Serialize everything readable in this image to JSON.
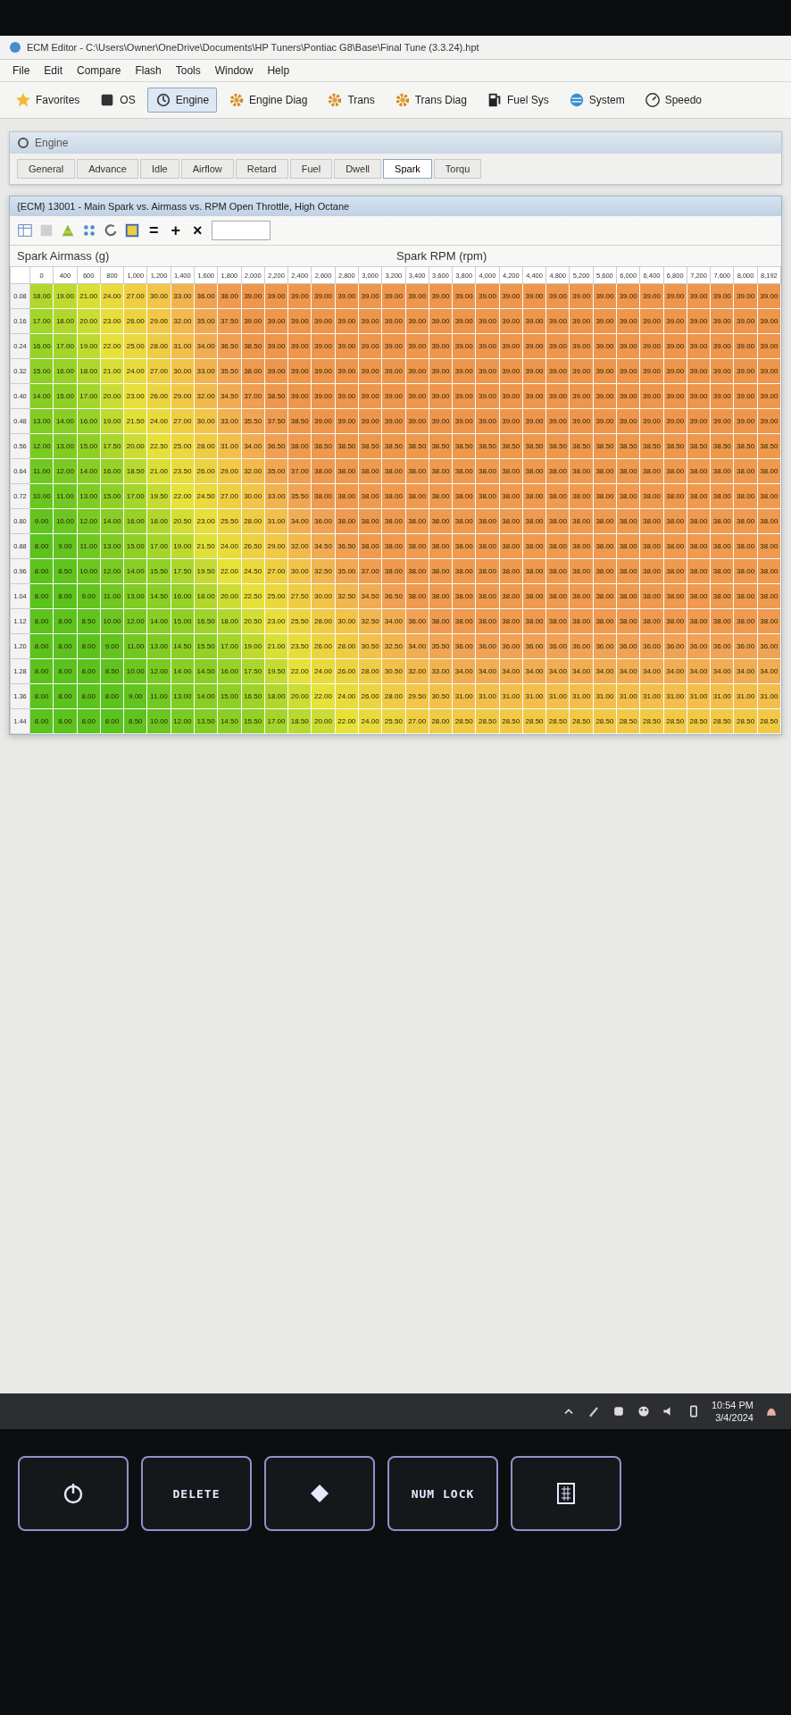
{
  "window": {
    "title": "ECM Editor - C:\\Users\\Owner\\OneDrive\\Documents\\HP Tuners\\Pontiac G8\\Base\\Final Tune (3.3.24).hpt"
  },
  "menu": [
    "File",
    "Edit",
    "Compare",
    "Flash",
    "Tools",
    "Window",
    "Help"
  ],
  "toolbar": [
    {
      "label": "Favorites",
      "selected": false
    },
    {
      "label": "OS",
      "selected": false
    },
    {
      "label": "Engine",
      "selected": true
    },
    {
      "label": "Engine Diag",
      "selected": false
    },
    {
      "label": "Trans",
      "selected": false
    },
    {
      "label": "Trans Diag",
      "selected": false
    },
    {
      "label": "Fuel Sys",
      "selected": false
    },
    {
      "label": "System",
      "selected": false
    },
    {
      "label": "Speedo",
      "selected": false
    }
  ],
  "engine_panel": {
    "title": "Engine",
    "tabs": [
      {
        "label": "General",
        "selected": false
      },
      {
        "label": "Advance",
        "selected": false
      },
      {
        "label": "Idle",
        "selected": false
      },
      {
        "label": "Airflow",
        "selected": false
      },
      {
        "label": "Retard",
        "selected": false
      },
      {
        "label": "Fuel",
        "selected": false
      },
      {
        "label": "Dwell",
        "selected": false
      },
      {
        "label": "Spark",
        "selected": true
      },
      {
        "label": "Torqu",
        "selected": false
      }
    ]
  },
  "table_window": {
    "title": "{ECM} 13001 - Main Spark vs. Airmass vs. RPM Open Throttle, High Octane",
    "tools": [
      "=",
      "+",
      "×"
    ],
    "x_axis_label": "Spark RPM (rpm)",
    "y_axis_label": "Spark Airmass (g)",
    "columns": [
      "0",
      "400",
      "600",
      "800",
      "1,000",
      "1,200",
      "1,400",
      "1,600",
      "1,800",
      "2,000",
      "2,200",
      "2,400",
      "2,600",
      "2,800",
      "3,000",
      "3,200",
      "3,400",
      "3,600",
      "3,800",
      "4,000",
      "4,200",
      "4,400",
      "4,800",
      "5,200",
      "5,600",
      "6,000",
      "6,400",
      "6,800",
      "7,200",
      "7,600",
      "8,000",
      "8,192"
    ],
    "rows": [
      {
        "label": "0.08",
        "values": [
          "18.00",
          "19.00",
          "21.00",
          "24.00",
          "27.00",
          "30.00",
          "33.00",
          "36.00",
          "38.00",
          "39.00",
          "39.00",
          "39.00",
          "39.00",
          "39.00",
          "39.00",
          "39.00",
          "39.00",
          "39.00",
          "39.00",
          "39.00",
          "39.00",
          "39.00",
          "39.00",
          "39.00",
          "39.00",
          "39.00",
          "39.00",
          "39.00",
          "39.00",
          "39.00",
          "39.00",
          "39.00"
        ]
      },
      {
        "label": "0.16",
        "values": [
          "17.00",
          "18.00",
          "20.00",
          "23.00",
          "26.00",
          "29.00",
          "32.00",
          "35.00",
          "37.50",
          "39.00",
          "39.00",
          "39.00",
          "39.00",
          "39.00",
          "39.00",
          "39.00",
          "39.00",
          "39.00",
          "39.00",
          "39.00",
          "39.00",
          "39.00",
          "39.00",
          "39.00",
          "39.00",
          "39.00",
          "39.00",
          "39.00",
          "39.00",
          "39.00",
          "39.00",
          "39.00"
        ]
      },
      {
        "label": "0.24",
        "values": [
          "16.00",
          "17.00",
          "19.00",
          "22.00",
          "25.00",
          "28.00",
          "31.00",
          "34.00",
          "36.50",
          "38.50",
          "39.00",
          "39.00",
          "39.00",
          "39.00",
          "39.00",
          "39.00",
          "39.00",
          "39.00",
          "39.00",
          "39.00",
          "39.00",
          "39.00",
          "39.00",
          "39.00",
          "39.00",
          "39.00",
          "39.00",
          "39.00",
          "39.00",
          "39.00",
          "39.00",
          "39.00"
        ]
      },
      {
        "label": "0.32",
        "values": [
          "15.00",
          "16.00",
          "18.00",
          "21.00",
          "24.00",
          "27.00",
          "30.00",
          "33.00",
          "35.50",
          "38.00",
          "39.00",
          "39.00",
          "39.00",
          "39.00",
          "39.00",
          "39.00",
          "39.00",
          "39.00",
          "39.00",
          "39.00",
          "39.00",
          "39.00",
          "39.00",
          "39.00",
          "39.00",
          "39.00",
          "39.00",
          "39.00",
          "39.00",
          "39.00",
          "39.00",
          "39.00"
        ]
      },
      {
        "label": "0.40",
        "values": [
          "14.00",
          "15.00",
          "17.00",
          "20.00",
          "23.00",
          "26.00",
          "29.00",
          "32.00",
          "34.50",
          "37.00",
          "38.50",
          "39.00",
          "39.00",
          "39.00",
          "39.00",
          "39.00",
          "39.00",
          "39.00",
          "39.00",
          "39.00",
          "39.00",
          "39.00",
          "39.00",
          "39.00",
          "39.00",
          "39.00",
          "39.00",
          "39.00",
          "39.00",
          "39.00",
          "39.00",
          "39.00"
        ]
      },
      {
        "label": "0.48",
        "values": [
          "13.00",
          "14.00",
          "16.00",
          "19.00",
          "21.50",
          "24.00",
          "27.00",
          "30.00",
          "33.00",
          "35.50",
          "37.50",
          "38.50",
          "39.00",
          "39.00",
          "39.00",
          "39.00",
          "39.00",
          "39.00",
          "39.00",
          "39.00",
          "39.00",
          "39.00",
          "39.00",
          "39.00",
          "39.00",
          "39.00",
          "39.00",
          "39.00",
          "39.00",
          "39.00",
          "39.00",
          "39.00"
        ]
      },
      {
        "label": "0.56",
        "values": [
          "12.00",
          "13.00",
          "15.00",
          "17.50",
          "20.00",
          "22.50",
          "25.00",
          "28.00",
          "31.00",
          "34.00",
          "36.50",
          "38.00",
          "38.50",
          "38.50",
          "38.50",
          "38.50",
          "38.50",
          "38.50",
          "38.50",
          "38.50",
          "38.50",
          "38.50",
          "38.50",
          "38.50",
          "38.50",
          "38.50",
          "38.50",
          "38.50",
          "38.50",
          "38.50",
          "38.50",
          "38.50"
        ]
      },
      {
        "label": "0.64",
        "values": [
          "11.00",
          "12.00",
          "14.00",
          "16.00",
          "18.50",
          "21.00",
          "23.50",
          "26.00",
          "29.00",
          "32.00",
          "35.00",
          "37.00",
          "38.00",
          "38.00",
          "38.00",
          "38.00",
          "38.00",
          "38.00",
          "38.00",
          "38.00",
          "38.00",
          "38.00",
          "38.00",
          "38.00",
          "38.00",
          "38.00",
          "38.00",
          "38.00",
          "38.00",
          "38.00",
          "38.00",
          "38.00"
        ]
      },
      {
        "label": "0.72",
        "values": [
          "10.00",
          "11.00",
          "13.00",
          "15.00",
          "17.00",
          "19.50",
          "22.00",
          "24.50",
          "27.00",
          "30.00",
          "33.00",
          "35.50",
          "38.00",
          "38.00",
          "38.00",
          "38.00",
          "38.00",
          "38.00",
          "38.00",
          "38.00",
          "38.00",
          "38.00",
          "38.00",
          "38.00",
          "38.00",
          "38.00",
          "38.00",
          "38.00",
          "38.00",
          "38.00",
          "38.00",
          "38.00"
        ]
      },
      {
        "label": "0.80",
        "values": [
          "9.00",
          "10.00",
          "12.00",
          "14.00",
          "16.00",
          "18.00",
          "20.50",
          "23.00",
          "25.50",
          "28.00",
          "31.00",
          "34.00",
          "36.00",
          "38.00",
          "38.00",
          "38.00",
          "38.00",
          "38.00",
          "38.00",
          "38.00",
          "38.00",
          "38.00",
          "38.00",
          "38.00",
          "38.00",
          "38.00",
          "38.00",
          "38.00",
          "38.00",
          "38.00",
          "38.00",
          "38.00"
        ]
      },
      {
        "label": "0.88",
        "values": [
          "8.00",
          "9.00",
          "11.00",
          "13.00",
          "15.00",
          "17.00",
          "19.00",
          "21.50",
          "24.00",
          "26.50",
          "29.00",
          "32.00",
          "34.50",
          "36.50",
          "38.00",
          "38.00",
          "38.00",
          "38.00",
          "38.00",
          "38.00",
          "38.00",
          "38.00",
          "38.00",
          "38.00",
          "38.00",
          "38.00",
          "38.00",
          "38.00",
          "38.00",
          "38.00",
          "38.00",
          "38.00"
        ]
      },
      {
        "label": "0.96",
        "values": [
          "8.00",
          "8.50",
          "10.00",
          "12.00",
          "14.00",
          "15.50",
          "17.50",
          "19.50",
          "22.00",
          "24.50",
          "27.00",
          "30.00",
          "32.50",
          "35.00",
          "37.00",
          "38.00",
          "38.00",
          "38.00",
          "38.00",
          "38.00",
          "38.00",
          "38.00",
          "38.00",
          "38.00",
          "38.00",
          "38.00",
          "38.00",
          "38.00",
          "38.00",
          "38.00",
          "38.00",
          "38.00"
        ]
      },
      {
        "label": "1.04",
        "values": [
          "8.00",
          "8.00",
          "9.00",
          "11.00",
          "13.00",
          "14.50",
          "16.00",
          "18.00",
          "20.00",
          "22.50",
          "25.00",
          "27.50",
          "30.00",
          "32.50",
          "34.50",
          "36.50",
          "38.00",
          "38.00",
          "38.00",
          "38.00",
          "38.00",
          "38.00",
          "38.00",
          "38.00",
          "38.00",
          "38.00",
          "38.00",
          "38.00",
          "38.00",
          "38.00",
          "38.00",
          "38.00"
        ]
      },
      {
        "label": "1.12",
        "values": [
          "8.00",
          "8.00",
          "8.50",
          "10.00",
          "12.00",
          "14.00",
          "15.00",
          "16.50",
          "18.00",
          "20.50",
          "23.00",
          "25.50",
          "28.00",
          "30.00",
          "32.50",
          "34.00",
          "36.00",
          "38.00",
          "38.00",
          "38.00",
          "38.00",
          "38.00",
          "38.00",
          "38.00",
          "38.00",
          "38.00",
          "38.00",
          "38.00",
          "38.00",
          "38.00",
          "38.00",
          "38.00"
        ]
      },
      {
        "label": "1.20",
        "values": [
          "8.00",
          "8.00",
          "8.00",
          "9.00",
          "11.00",
          "13.00",
          "14.50",
          "15.50",
          "17.00",
          "19.00",
          "21.00",
          "23.50",
          "26.00",
          "28.00",
          "30.50",
          "32.50",
          "34.00",
          "35.50",
          "36.00",
          "36.00",
          "36.00",
          "36.00",
          "36.00",
          "36.00",
          "36.00",
          "36.00",
          "36.00",
          "36.00",
          "36.00",
          "36.00",
          "36.00",
          "36.00"
        ]
      },
      {
        "label": "1.28",
        "values": [
          "8.00",
          "8.00",
          "8.00",
          "8.50",
          "10.00",
          "12.00",
          "14.00",
          "14.50",
          "16.00",
          "17.50",
          "19.50",
          "22.00",
          "24.00",
          "26.00",
          "28.00",
          "30.50",
          "32.00",
          "33.00",
          "34.00",
          "34.00",
          "34.00",
          "34.00",
          "34.00",
          "34.00",
          "34.00",
          "34.00",
          "34.00",
          "34.00",
          "34.00",
          "34.00",
          "34.00",
          "34.00"
        ]
      },
      {
        "label": "1.36",
        "values": [
          "8.00",
          "8.00",
          "8.00",
          "8.00",
          "9.00",
          "11.00",
          "13.00",
          "14.00",
          "15.00",
          "16.50",
          "18.00",
          "20.00",
          "22.00",
          "24.00",
          "26.00",
          "28.00",
          "29.50",
          "30.50",
          "31.00",
          "31.00",
          "31.00",
          "31.00",
          "31.00",
          "31.00",
          "31.00",
          "31.00",
          "31.00",
          "31.00",
          "31.00",
          "31.00",
          "31.00",
          "31.00"
        ]
      },
      {
        "label": "1.44",
        "values": [
          "8.00",
          "8.00",
          "8.00",
          "8.00",
          "8.50",
          "10.00",
          "12.00",
          "13.50",
          "14.50",
          "15.50",
          "17.00",
          "18.50",
          "20.00",
          "22.00",
          "24.00",
          "25.50",
          "27.00",
          "28.00",
          "28.50",
          "28.50",
          "28.50",
          "28.50",
          "28.50",
          "28.50",
          "28.50",
          "28.50",
          "28.50",
          "28.50",
          "28.50",
          "28.50",
          "28.50",
          "28.50"
        ]
      }
    ]
  },
  "taskbar": {
    "time": "10:54 PM",
    "date": "3/4/2024"
  },
  "keyboard": {
    "keys": [
      {
        "kind": "power"
      },
      {
        "kind": "text",
        "label": "DELETE"
      },
      {
        "kind": "diamond"
      },
      {
        "kind": "text",
        "label": "NUM LOCK"
      },
      {
        "kind": "calculator"
      }
    ]
  }
}
